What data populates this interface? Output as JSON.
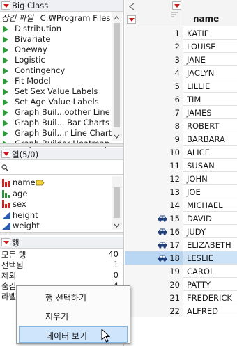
{
  "table_panel": {
    "title": "Big Class",
    "locked_file_prefix": "잠긴 파일",
    "locked_file_path": "C:₩Program Files"
  },
  "scripts": [
    "Distribution",
    "Bivariate",
    "Oneway",
    "Logistic",
    "Contingency",
    "Fit Model",
    "Set Sex Value Labels",
    "Set Age Value Labels",
    "Graph Buil...oother Line",
    "Graph Buil... Bar Charts",
    "Graph Buil...r Line Chart",
    "Graph Builder Heatmap"
  ],
  "columns_panel": {
    "title": "열(5/0)",
    "search_placeholder": "",
    "columns": [
      {
        "name": "name",
        "icon": "nominal-red-bar-icon",
        "tag": "label-tag-icon"
      },
      {
        "name": "age",
        "icon": "ordinal-green-bar-icon"
      },
      {
        "name": "sex",
        "icon": "nominal-red-bar-icon"
      },
      {
        "name": "height",
        "icon": "continuous-blue-triangle-icon"
      },
      {
        "name": "weight",
        "icon": "continuous-blue-triangle-icon"
      }
    ]
  },
  "rows_panel": {
    "title": "행",
    "items": [
      {
        "label": "모든 행",
        "value": "40"
      },
      {
        "label": "선택됨",
        "value": "1"
      },
      {
        "label": "제외",
        "value": "0"
      },
      {
        "label": "숨김",
        "value": "4"
      },
      {
        "label": "라벨",
        "value": "0"
      }
    ]
  },
  "data_table": {
    "column_header": "name",
    "rows": [
      {
        "n": "1",
        "name": "KATIE",
        "hidden": false,
        "selected": false
      },
      {
        "n": "2",
        "name": "LOUISE",
        "hidden": false,
        "selected": false
      },
      {
        "n": "3",
        "name": "JANE",
        "hidden": false,
        "selected": false
      },
      {
        "n": "4",
        "name": "JACLYN",
        "hidden": false,
        "selected": false
      },
      {
        "n": "5",
        "name": "LILLIE",
        "hidden": false,
        "selected": false
      },
      {
        "n": "6",
        "name": "TIM",
        "hidden": false,
        "selected": false
      },
      {
        "n": "7",
        "name": "JAMES",
        "hidden": false,
        "selected": false
      },
      {
        "n": "8",
        "name": "ROBERT",
        "hidden": false,
        "selected": false
      },
      {
        "n": "9",
        "name": "BARBARA",
        "hidden": false,
        "selected": false
      },
      {
        "n": "10",
        "name": "ALICE",
        "hidden": false,
        "selected": false
      },
      {
        "n": "11",
        "name": "SUSAN",
        "hidden": false,
        "selected": false
      },
      {
        "n": "12",
        "name": "JOHN",
        "hidden": false,
        "selected": false
      },
      {
        "n": "13",
        "name": "JOE",
        "hidden": false,
        "selected": false
      },
      {
        "n": "14",
        "name": "MICHAEL",
        "hidden": false,
        "selected": false
      },
      {
        "n": "15",
        "name": "DAVID",
        "hidden": true,
        "selected": false
      },
      {
        "n": "16",
        "name": "JUDY",
        "hidden": true,
        "selected": false
      },
      {
        "n": "17",
        "name": "ELIZABETH",
        "hidden": true,
        "selected": false
      },
      {
        "n": "18",
        "name": "LESLIE",
        "hidden": true,
        "selected": true
      },
      {
        "n": "19",
        "name": "CAROL",
        "hidden": false,
        "selected": false
      },
      {
        "n": "20",
        "name": "PATTY",
        "hidden": false,
        "selected": false
      },
      {
        "n": "21",
        "name": "FREDERICK",
        "hidden": false,
        "selected": false
      },
      {
        "n": "22",
        "name": "ALFRED",
        "hidden": false,
        "selected": false
      }
    ]
  },
  "context_menu": {
    "items": [
      {
        "label": "행 선택하기",
        "highlighted": false
      },
      {
        "label": "지우기",
        "highlighted": false
      },
      {
        "label": "데이터 보기",
        "highlighted": true
      }
    ]
  },
  "colors": {
    "selected_row": "#cde3f7",
    "hidden_icon": "#1f3f7a",
    "script_play": "#2e9a3a",
    "menu_triangle": "#cc1a1a"
  }
}
